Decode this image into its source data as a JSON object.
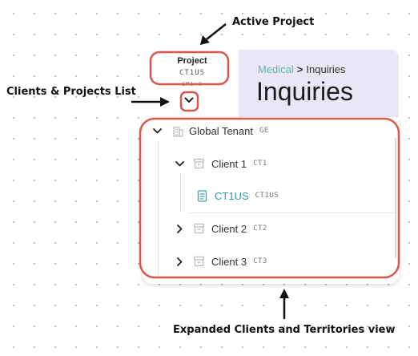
{
  "annotations": {
    "active_project": "Active Project",
    "clients_projects_list": "Clients & Projects List",
    "expanded_view": "Expanded Clients and Territories view"
  },
  "project_selector": {
    "label": "Project",
    "code": "CT1US",
    "secondary": "GM1+0"
  },
  "header": {
    "breadcrumb_parent": "Medical",
    "breadcrumb_separator": ">",
    "breadcrumb_current": "Inquiries",
    "title": "Inquiries"
  },
  "tree": {
    "tenant": {
      "name": "Global Tenant",
      "code": "GE"
    },
    "clients": [
      {
        "name": "Client 1",
        "code": "CT1",
        "expanded": true,
        "projects": [
          {
            "name": "CT1US",
            "code": "CT1US",
            "selected": true
          }
        ]
      },
      {
        "name": "Client 2",
        "code": "CT2",
        "expanded": false
      },
      {
        "name": "Client 3",
        "code": "CT3",
        "expanded": false
      }
    ]
  },
  "colors": {
    "highlight_outline": "#d9574b",
    "accent_teal": "#57b9b0",
    "header_bg": "#ebe6f5",
    "selected_text": "#2a9da8"
  },
  "icons": {
    "tenant": "building-icon",
    "client": "archive-box-icon",
    "project": "document-icon",
    "expanded": "chevron-down-icon",
    "collapsed": "chevron-right-icon"
  }
}
